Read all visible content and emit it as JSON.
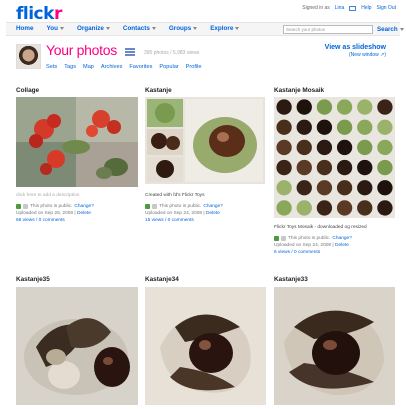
{
  "header": {
    "logo_main": "flick",
    "logo_accent": "r",
    "signed_in": "Signed in as",
    "username": "Lina",
    "help": "Help",
    "signout": "Sign Out",
    "menu": [
      {
        "label": "Home"
      },
      {
        "label": "You"
      },
      {
        "label": "Organize"
      },
      {
        "label": "Contacts"
      },
      {
        "label": "Groups"
      },
      {
        "label": "Explore"
      }
    ],
    "search_placeholder": "Search your photos",
    "search_label": "Search"
  },
  "profile": {
    "title": "Your photos",
    "counts": "395 photos / 5,983 views",
    "links": [
      "Sets",
      "Tags",
      "Map",
      "Archives",
      "Favorites",
      "Popular",
      "Profile"
    ],
    "slideshow": "View as slideshow",
    "slideshow_sub": "(New window ↗)"
  },
  "photos": [
    {
      "title": "Collage",
      "description": "click here to add a description",
      "privacy": "This photo is public.",
      "change": "Change?",
      "uploaded": "Uploaded on Sep 26, 2008",
      "delete": "Delete",
      "stats": "65 views / 0 comments"
    },
    {
      "title": "Kastanje",
      "description": "Created with fd's Flickr Toys",
      "privacy": "This photo is public.",
      "change": "Change?",
      "uploaded": "Uploaded on Sep 24, 2008",
      "delete": "Delete",
      "stats": "15 views / 0 comments"
    },
    {
      "title": "Kastanje Mosaik",
      "description": "Flickr Toys Mosaik - downloaded og resized",
      "privacy": "This photo is public.",
      "change": "Change?",
      "uploaded": "Uploaded on Sep 24, 2008",
      "delete": "Delete",
      "stats": "6 views / 0 comments"
    },
    {
      "title": "Kastanje35"
    },
    {
      "title": "Kastanje34"
    },
    {
      "title": "Kastanje33"
    }
  ],
  "colors": {
    "brand_blue": "#0063dc",
    "brand_pink": "#ff0084"
  }
}
